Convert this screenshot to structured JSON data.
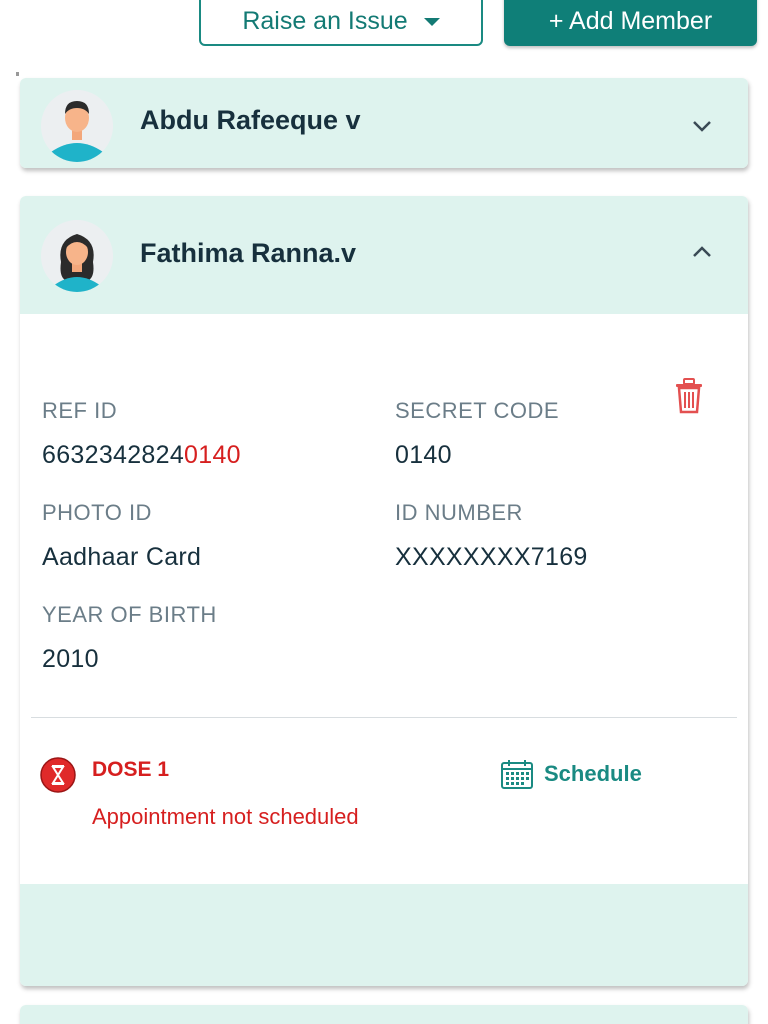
{
  "toolbar": {
    "raise_issue_label": "Raise an Issue",
    "add_member_label": "+ Add Member"
  },
  "members": [
    {
      "name": "Abdu Rafeeque v",
      "expanded": false,
      "avatar": "male-avatar-icon"
    },
    {
      "name": "Fathima Ranna.v",
      "expanded": true,
      "avatar": "female-avatar-icon",
      "details": {
        "ref_id_label": "REF ID",
        "ref_id_prefix": "6632342824",
        "ref_id_suffix": "0140",
        "secret_code_label": "SECRET CODE",
        "secret_code": "0140",
        "photo_id_label": "PHOTO ID",
        "photo_id": "Aadhaar Card",
        "id_number_label": "ID NUMBER",
        "id_number": "XXXXXXXX7169",
        "yob_label": "YEAR OF BIRTH",
        "yob": "2010"
      },
      "dose": {
        "label": "DOSE 1",
        "status": "Appointment not scheduled",
        "schedule_label": "Schedule"
      }
    }
  ],
  "colors": {
    "accent": "#0f7f78",
    "card_header_bg": "#def3ee",
    "alert": "#d61f1f"
  }
}
